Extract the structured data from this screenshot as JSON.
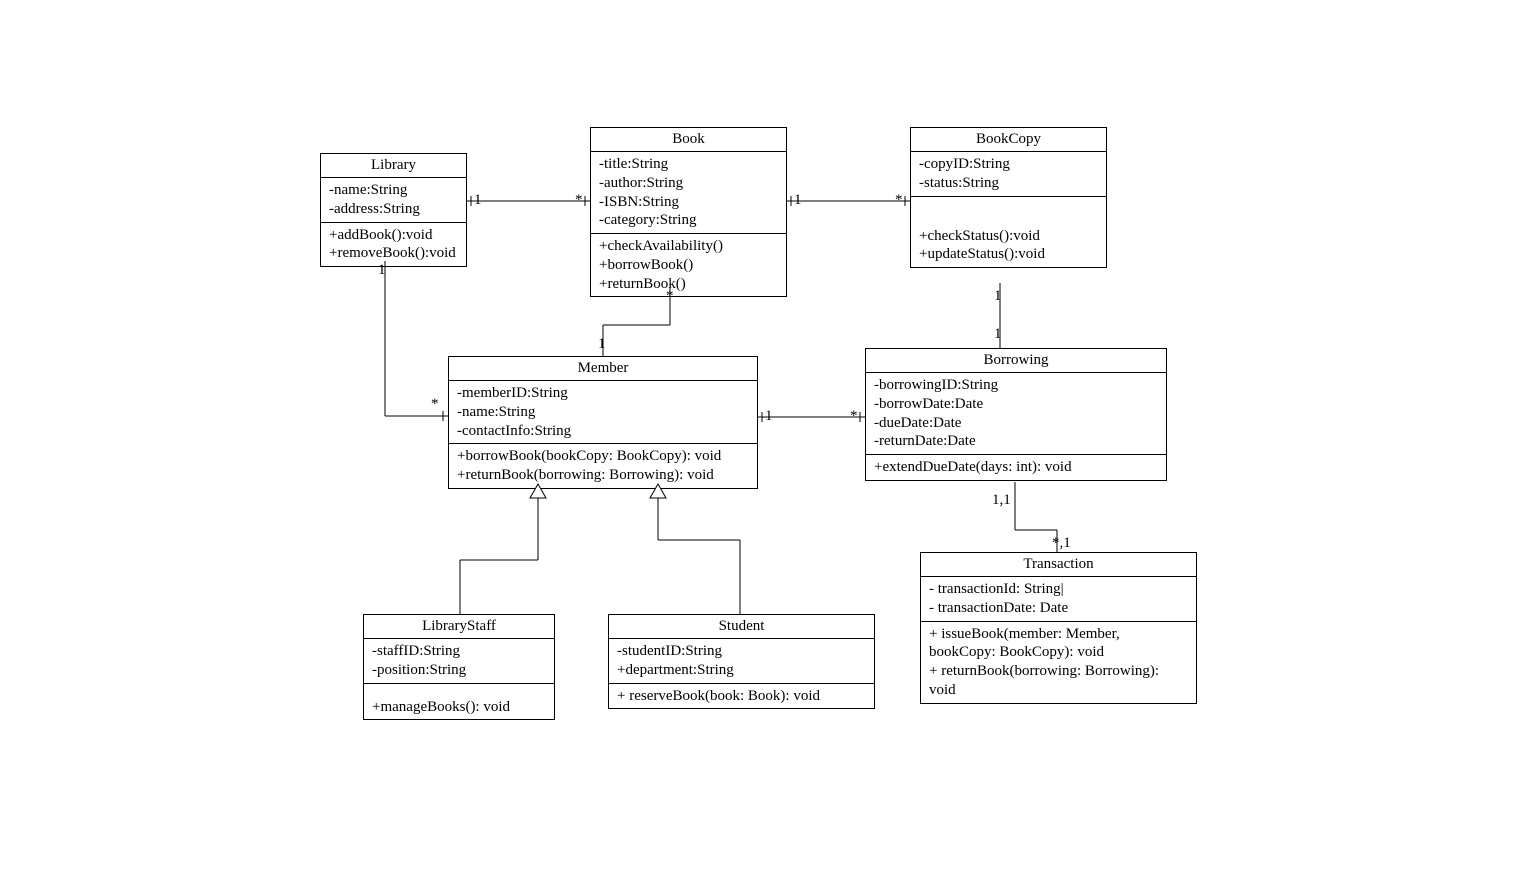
{
  "classes": {
    "library": {
      "name": "Library",
      "attrs": [
        "-name:String",
        "-address:String"
      ],
      "ops": [
        "+addBook():void",
        "+removeBook():void"
      ]
    },
    "book": {
      "name": "Book",
      "attrs": [
        "-title:String",
        "-author:String",
        "-ISBN:String",
        "-category:String"
      ],
      "ops": [
        "+checkAvailability()",
        "+borrowBook()",
        "+returnBook()"
      ]
    },
    "bookcopy": {
      "name": "BookCopy",
      "attrs": [
        "-copyID:String",
        "-status:String"
      ],
      "ops": [
        "+checkStatus():void",
        "+updateStatus():void"
      ]
    },
    "member": {
      "name": "Member",
      "attrs": [
        "-memberID:String",
        "-name:String",
        "-contactInfo:String"
      ],
      "ops": [
        "+borrowBook(bookCopy: BookCopy): void",
        "+returnBook(borrowing: Borrowing): void"
      ]
    },
    "borrowing": {
      "name": "Borrowing",
      "attrs": [
        "-borrowingID:String",
        "-borrowDate:Date",
        "-dueDate:Date",
        "-returnDate:Date"
      ],
      "ops": [
        "+extendDueDate(days: int): void"
      ]
    },
    "librarystaff": {
      "name": "LibraryStaff",
      "attrs": [
        "-staffID:String",
        "-position:String"
      ],
      "ops": [
        "+manageBooks(): void"
      ]
    },
    "student": {
      "name": "Student",
      "attrs": [
        "-studentID:String",
        "+department:String"
      ],
      "ops": [
        "+ reserveBook(book: Book): void"
      ]
    },
    "transaction": {
      "name": "Transaction",
      "attrs": [
        "- transactionId: String|",
        "- transactionDate: Date"
      ],
      "ops": [
        "+ issueBook(member: Member, bookCopy: BookCopy): void",
        "+ returnBook(borrowing: Borrowing): void"
      ]
    }
  },
  "multiplicities": {
    "lib_book_left": "1",
    "lib_book_right": "*",
    "book_copy_left": "1",
    "book_copy_right": "*",
    "lib_member_top": "1",
    "lib_member_bottom": "*",
    "book_member_top": "*",
    "book_member_bottom": "1",
    "member_borrow_left": "1",
    "member_borrow_right": "*",
    "copy_borrow_top": "1",
    "copy_borrow_bottom": "1",
    "borrow_trans_top": "1,1",
    "borrow_trans_bottom": "*,1"
  }
}
